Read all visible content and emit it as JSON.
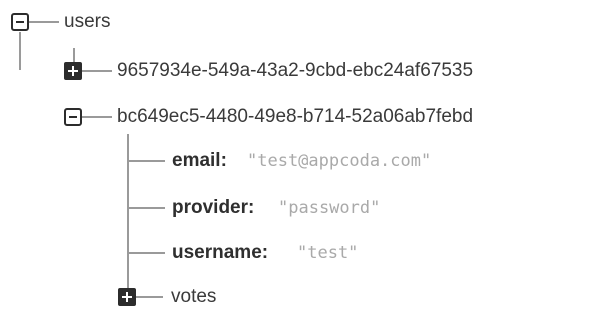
{
  "tree": {
    "root": {
      "label": "users",
      "expanded": true,
      "children": [
        {
          "label": "9657934e-549a-43a2-9cbd-ebc24af67535",
          "expanded": false
        },
        {
          "label": "bc649ec5-4480-49e8-b714-52a06ab7febd",
          "expanded": true,
          "fields": [
            {
              "key": "email:",
              "value": "\"test@appcoda.com\""
            },
            {
              "key": "provider:",
              "value": "\"password\""
            },
            {
              "key": "username:",
              "value": "\"test\""
            }
          ],
          "children": [
            {
              "label": "votes",
              "expanded": false
            }
          ]
        }
      ]
    }
  },
  "colors": {
    "line": "#9a9a9a",
    "toggle_fill": "#2c2c2c",
    "label_text": "#3a3a3a",
    "value_text": "#a9a9a9"
  },
  "icons": {
    "expanded": "minus-square-icon",
    "collapsed": "plus-square-icon"
  }
}
